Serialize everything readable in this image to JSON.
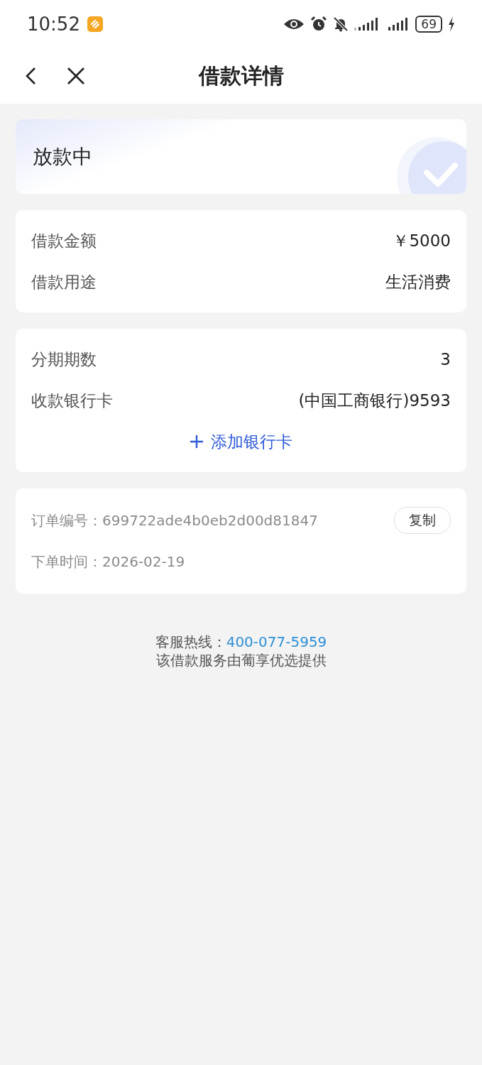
{
  "status_bar": {
    "time": "10:52",
    "battery": "69"
  },
  "header": {
    "title": "借款详情"
  },
  "status_card": {
    "label": "放款中"
  },
  "loan_card": {
    "rows": [
      {
        "label": "借款金额",
        "value": "￥5000"
      },
      {
        "label": "借款用途",
        "value": "生活消费"
      }
    ]
  },
  "installment_card": {
    "rows": [
      {
        "label": "分期期数",
        "value": "3"
      },
      {
        "label": "收款银行卡",
        "value": "(中国工商银行)9593"
      }
    ],
    "add_card_link": "添加银行卡"
  },
  "order_card": {
    "rows": [
      {
        "label": "订单编号：",
        "value": "699722ade4b0eb2d00d81847",
        "action": "复制"
      },
      {
        "label": "下单时间：",
        "value": "2026-02-19"
      }
    ]
  },
  "footer": {
    "hotline_label": "客服热线：",
    "hotline": "400-077-5959",
    "provider": "该借款服务由葡享优选提供"
  }
}
